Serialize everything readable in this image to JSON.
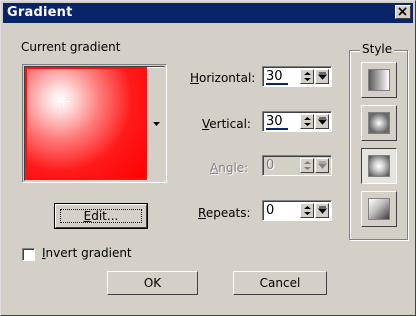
{
  "window": {
    "title": "Gradient"
  },
  "preview": {
    "label": "Current gradient"
  },
  "fields": {
    "horizontal": {
      "label_u": "H",
      "label_rest": "orizontal:",
      "value": "30"
    },
    "vertical": {
      "label_u": "V",
      "label_rest": "ertical:",
      "value": "30"
    },
    "angle": {
      "label_u": "A",
      "label_rest": "ngle:",
      "value": "0"
    },
    "repeats": {
      "label_u": "R",
      "label_rest": "epeats:",
      "value": "0"
    }
  },
  "style": {
    "label": "Style",
    "options": [
      "linear",
      "rectangular",
      "radial",
      "corner"
    ],
    "selected": "radial"
  },
  "edit_button": {
    "label_u": "E",
    "label_rest": "dit..."
  },
  "invert": {
    "label_u": "I",
    "label_rest": "nvert gradient",
    "checked": false
  },
  "buttons": {
    "ok": "OK",
    "cancel": "Cancel"
  },
  "colors": {
    "title_bar": "#0a246a",
    "gradient_start": "#ffffff",
    "gradient_end": "#ff0000",
    "face": "#d4d0c8"
  }
}
